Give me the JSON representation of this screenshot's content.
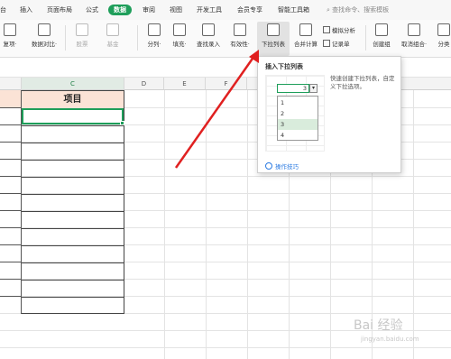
{
  "menu": {
    "tabs": [
      {
        "label": "台"
      },
      {
        "label": "插入"
      },
      {
        "label": "页面布局"
      },
      {
        "label": "公式"
      },
      {
        "label": "数据"
      },
      {
        "label": "审阅"
      },
      {
        "label": "视图"
      },
      {
        "label": "开发工具"
      },
      {
        "label": "会员专享"
      },
      {
        "label": "智能工具箱"
      }
    ],
    "active_tab": "数据",
    "search_placeholder": "查找命令、搜索模板"
  },
  "ribbon": {
    "tools": [
      {
        "label": "复项·",
        "icon": "duplicate-icon"
      },
      {
        "label": "数据对比·",
        "icon": "compare-icon"
      },
      {
        "label": "股票",
        "icon": "stock-icon"
      },
      {
        "label": "基金",
        "icon": "fund-icon"
      },
      {
        "label": "分列·",
        "icon": "split-column-icon"
      },
      {
        "label": "填充·",
        "icon": "fill-icon"
      },
      {
        "label": "查找录入",
        "icon": "lookup-entry-icon"
      },
      {
        "label": "有效性·",
        "icon": "validation-icon"
      },
      {
        "label": "下拉列表",
        "icon": "dropdown-list-icon"
      },
      {
        "label": "合并计算",
        "icon": "consolidate-icon"
      },
      {
        "label": "创建组",
        "icon": "group-icon"
      },
      {
        "label": "取消组合·",
        "icon": "ungroup-icon"
      },
      {
        "label": "分类",
        "icon": "subtotal-icon"
      }
    ],
    "mini_tools": [
      {
        "label": "模拟分析"
      },
      {
        "label": "记录单"
      }
    ]
  },
  "grid": {
    "columns": [
      "C",
      "D",
      "E",
      "F"
    ],
    "header_cell": "项目"
  },
  "popup": {
    "title": "插入下拉列表",
    "description": "快速创建下拉列表，自定义下拉选项。",
    "cell_value": "3",
    "options": [
      "1",
      "2",
      "3",
      "4"
    ],
    "highlighted_option": "3",
    "tips_link": "操作技巧"
  },
  "watermark": {
    "brand": "Bai 经验",
    "url": "jingyan.baidu.com"
  },
  "colors": {
    "accent": "#1e9e5a",
    "header_fill": "#fbe3d6",
    "arrow": "#e02020"
  }
}
